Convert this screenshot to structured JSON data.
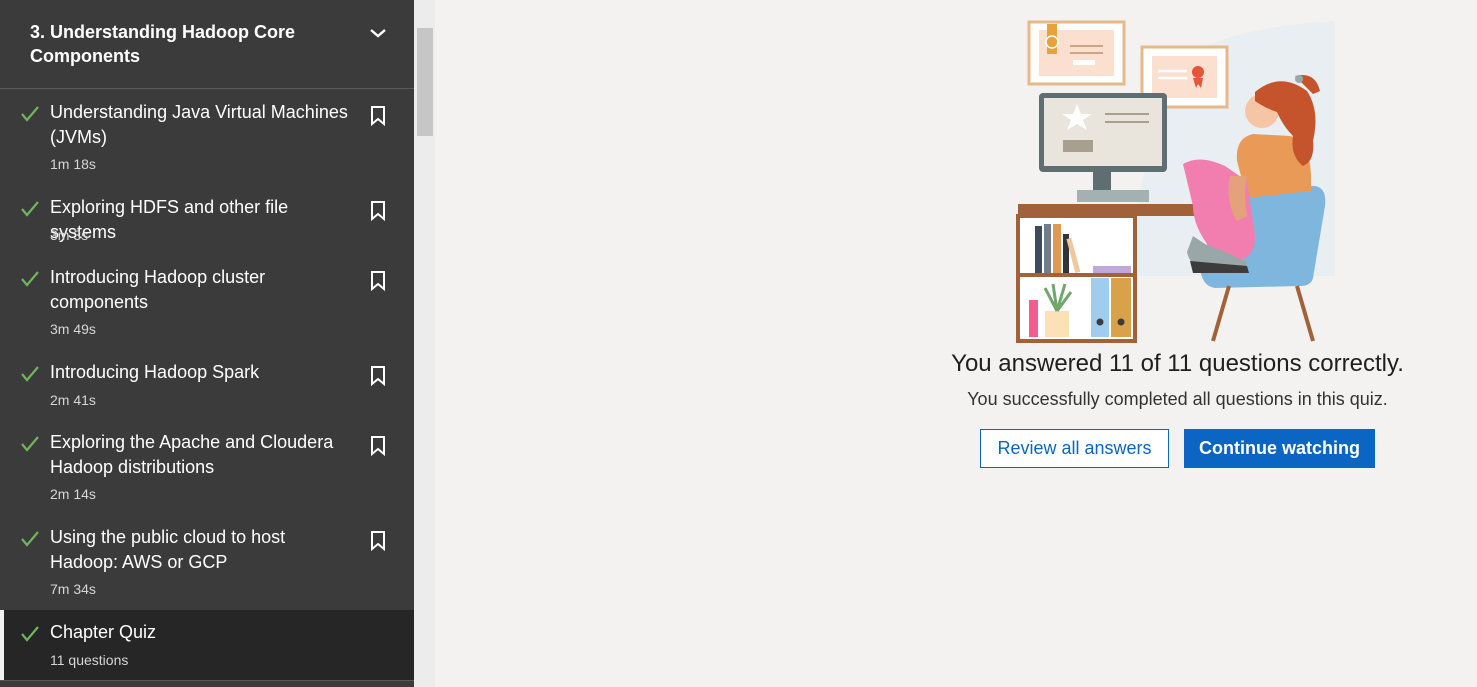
{
  "sidebar": {
    "chapter_title": "3. Understanding Hadoop Core Components",
    "items": [
      {
        "title": "Understanding Java Virtual Machines (JVMs)",
        "meta": "1m 18s"
      },
      {
        "title": "Exploring HDFS and other file systems",
        "meta": "3m 3s"
      },
      {
        "title": "Introducing Hadoop cluster components",
        "meta": "3m 49s"
      },
      {
        "title": "Introducing Hadoop Spark",
        "meta": "2m 41s"
      },
      {
        "title": "Exploring the Apache and Cloudera Hadoop distributions",
        "meta": "2m 14s"
      },
      {
        "title": "Using the public cloud to host Hadoop: AWS or GCP",
        "meta": "7m 34s"
      },
      {
        "title": "Chapter Quiz",
        "meta": "11 questions"
      }
    ]
  },
  "result": {
    "heading": "You answered 11 of 11 questions correctly.",
    "subtext": "You successfully completed all questions in this quiz.",
    "review_label": "Review all answers",
    "continue_label": "Continue watching"
  },
  "colors": {
    "accent": "#0a66c2",
    "check": "#70b55b",
    "sidebar_bg": "#3b3b3b",
    "active_bg": "#262626"
  },
  "icons": [
    "chevron-down-icon",
    "checkmark-icon",
    "bookmark-icon"
  ]
}
